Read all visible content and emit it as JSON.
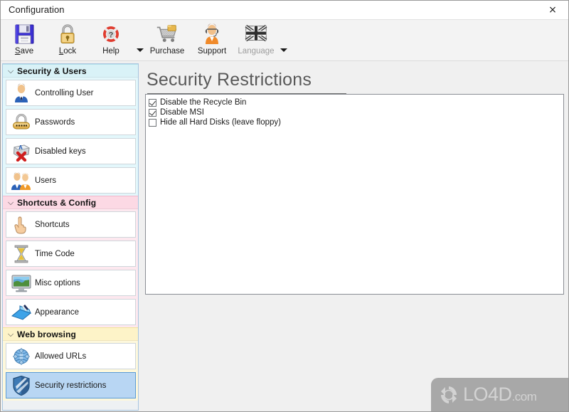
{
  "window": {
    "title": "Configuration",
    "close_label": "×"
  },
  "toolbar": {
    "items": [
      {
        "label": "Save",
        "icon": "floppy-disk-icon",
        "disabled": false,
        "underline": "S"
      },
      {
        "label": "Lock",
        "icon": "padlock-icon",
        "disabled": false,
        "underline": "L"
      },
      {
        "label": "Help",
        "icon": "help-lifering-icon",
        "disabled": false,
        "underline": ""
      },
      {
        "label": "Purchase",
        "icon": "shopping-cart-icon",
        "disabled": false,
        "underline": ""
      },
      {
        "label": "Support",
        "icon": "support-person-icon",
        "disabled": false,
        "underline": ""
      },
      {
        "label": "Language",
        "icon": "union-jack-flag-icon",
        "disabled": true,
        "underline": ""
      }
    ],
    "help_dropdown_arrow": "chevron-down-icon",
    "language_dropdown_arrow": "chevron-down-icon"
  },
  "sidebar": {
    "groups": [
      {
        "title": "Security & Users",
        "color": "#d9f2f7",
        "items": [
          {
            "label": "Controlling User",
            "icon": "user-suit-icon",
            "selected": false
          },
          {
            "label": "Passwords",
            "icon": "padlock-dots-icon",
            "selected": false
          },
          {
            "label": "Disabled keys",
            "icon": "key-disabled-icon",
            "selected": false
          },
          {
            "label": "Users",
            "icon": "two-users-icon",
            "selected": false
          }
        ]
      },
      {
        "title": "Shortcuts & Config",
        "color": "#fcd9e4",
        "items": [
          {
            "label": "Shortcuts",
            "icon": "pointing-hand-icon",
            "selected": false
          },
          {
            "label": "Time Code",
            "icon": "hourglass-icon",
            "selected": false
          },
          {
            "label": "Misc options",
            "icon": "monitor-icon",
            "selected": false
          },
          {
            "label": "Appearance",
            "icon": "paint-book-icon",
            "selected": false
          }
        ]
      },
      {
        "title": "Web browsing",
        "color": "#fdf3c8",
        "items": [
          {
            "label": "Allowed URLs",
            "icon": "globe-icon",
            "selected": false
          },
          {
            "label": "Security restrictions",
            "icon": "shield-icon",
            "selected": true
          }
        ]
      }
    ],
    "collapse_icon": "chevron-double-down-icon"
  },
  "main": {
    "page_title": "Security Restrictions",
    "options": [
      {
        "label": "Disable the Recycle Bin",
        "checked": true
      },
      {
        "label": "Disable MSI",
        "checked": true
      },
      {
        "label": "Hide all Hard Disks (leave floppy)",
        "checked": false
      }
    ]
  },
  "watermark": {
    "text_main": "LO4D",
    "text_suffix": ".com",
    "icon": "refresh-circular-arrows-icon"
  },
  "colors": {
    "accent_selected": "#b8d6f3",
    "accent_selected_border": "#5b9bd5",
    "group_security": "#d9f2f7",
    "group_shortcuts": "#fcd9e4",
    "group_web": "#fdf3c8",
    "title_text": "#595959"
  }
}
